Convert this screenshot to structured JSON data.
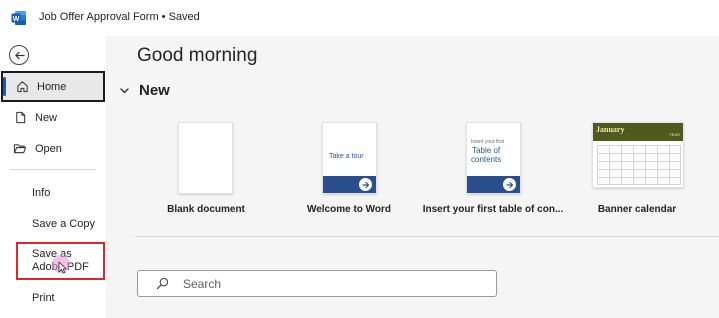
{
  "titlebar": {
    "app_icon": "word-logo-icon",
    "document_title": "Job Offer Approval Form • Saved"
  },
  "sidebar": {
    "back_icon": "back-arrow-icon",
    "items": [
      {
        "label": "Home",
        "icon": "home-icon",
        "selected": true
      },
      {
        "label": "New",
        "icon": "new-document-icon"
      },
      {
        "label": "Open",
        "icon": "folder-open-icon"
      },
      {
        "label": "Info"
      },
      {
        "label": "Save a Copy"
      },
      {
        "label": "Save as Adobe PDF",
        "highlighted": true
      },
      {
        "label": "Print"
      }
    ]
  },
  "main": {
    "greeting": "Good morning",
    "new_section": {
      "heading": "New",
      "templates": [
        {
          "label": "Blank document"
        },
        {
          "label": "Welcome to Word",
          "thumb_text": "Take a tour"
        },
        {
          "label": "Insert your first table of con...",
          "thumb_small": "Insert your first",
          "thumb_big_1": "Table of",
          "thumb_big_2": "contents"
        },
        {
          "label": "Banner calendar",
          "thumb_title": "January",
          "thumb_year": "YEAR"
        }
      ]
    },
    "search": {
      "placeholder": "Search",
      "value": ""
    }
  },
  "colors": {
    "word_blue": "#185abd",
    "highlight_red": "#e0252b",
    "main_background": "#f5f5f5",
    "calendar_header": "#4f5b1e"
  }
}
